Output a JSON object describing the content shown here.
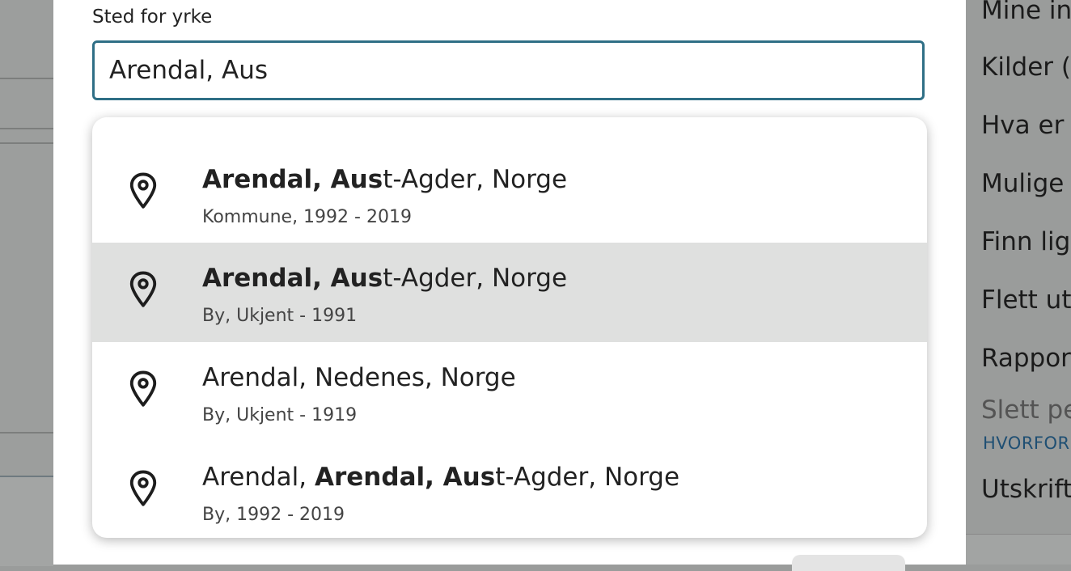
{
  "field": {
    "label": "Sted for yrke",
    "value": "Arendal, Aus"
  },
  "suggestions": [
    {
      "icon": "location-pin-icon",
      "title_bold_1": "Arendal, Aus",
      "title_normal_1": "t-Agder, Norge",
      "subtitle": "Kommune, 1992 - 2019",
      "highlighted": false
    },
    {
      "icon": "location-pin-icon",
      "title_bold_1": "Arendal, Aus",
      "title_normal_1": "t-Agder, Norge",
      "subtitle": "By, Ukjent - 1991",
      "highlighted": true
    },
    {
      "icon": "location-pin-icon",
      "title_normal_1": "Arendal, Nedenes, Norge",
      "subtitle": "By, Ukjent - 1919",
      "highlighted": false
    },
    {
      "icon": "location-pin-icon",
      "title_normal_0": "Arendal, ",
      "title_bold_1": "Arendal, Aus",
      "title_normal_1": "t-Agder, Norge",
      "subtitle": "By, 1992 - 2019",
      "highlighted": false
    }
  ],
  "side_menu": {
    "items": [
      "Mine in",
      "Kilder (",
      "Hva er r",
      "Mulige",
      "Finn lig",
      "Flett utf",
      "Rappor",
      "Slett pe",
      "Utskrift"
    ],
    "sub_link": "HVORFOR"
  },
  "colors": {
    "input_border": "#2f6f86",
    "highlight_bg": "#dfe0df",
    "overlay": "#9a9c9b",
    "link": "#1f4f73"
  }
}
